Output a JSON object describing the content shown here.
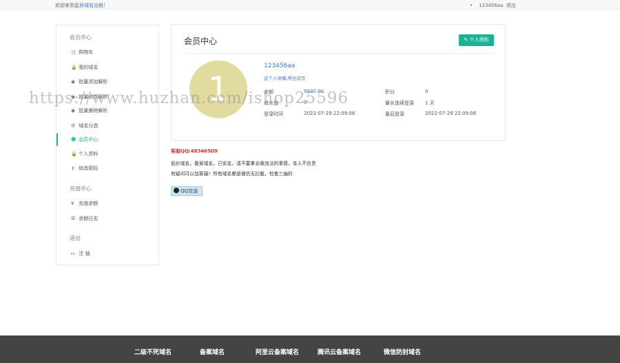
{
  "topbar": {
    "welcome_prefix": "欢迎来到",
    "welcome_site": "星辰域名出租！",
    "user_bullet": "•",
    "username": "123456aa",
    "logout": "退出"
  },
  "sidebar": {
    "groups": [
      {
        "label": "会员中心"
      },
      {
        "label": "充值中心"
      },
      {
        "label": "退出"
      }
    ],
    "items": [
      {
        "icon": "cart-icon",
        "glyph": "🛒",
        "label": "购物车"
      },
      {
        "icon": "lock-icon",
        "glyph": "🔒",
        "label": "我的域名"
      },
      {
        "icon": "globe-icon",
        "glyph": "◉",
        "label": "批量添加解析"
      },
      {
        "icon": "globe-icon",
        "glyph": "◉",
        "label": "批量修改解析"
      },
      {
        "icon": "globe-icon",
        "glyph": "◉",
        "label": "批量删除解析"
      },
      {
        "icon": "gears-icon",
        "glyph": "⚙",
        "label": "域名分选"
      },
      {
        "icon": "user-circle-icon",
        "glyph": "☻",
        "label": "会员中心"
      },
      {
        "icon": "lock-icon",
        "glyph": "🔒",
        "label": "个人资料"
      },
      {
        "icon": "key-icon",
        "glyph": "⚷",
        "label": "修改密码"
      },
      {
        "icon": "yen-icon",
        "glyph": "¥",
        "label": "充值余额"
      },
      {
        "icon": "list-icon",
        "glyph": "☰",
        "label": "余额日志"
      },
      {
        "icon": "signout-icon",
        "glyph": "↦",
        "label": "注 销"
      }
    ]
  },
  "panel": {
    "title": "会员中心",
    "profile_button": "个人资料",
    "avatar_text": "1",
    "username": "123456aa",
    "signature": "这个人很懒,啥也没写",
    "stats": [
      {
        "label": "余额",
        "value": "9930.00"
      },
      {
        "label": "积分",
        "value": "0"
      },
      {
        "label": "成长值",
        "value": "0"
      },
      {
        "label": "最长连续登录",
        "value": "1 天"
      },
      {
        "label": "登录时间",
        "value": "2022-07-29 22:09:06"
      },
      {
        "label": "最后登录",
        "value": "2022-07-29 22:09:06"
      }
    ]
  },
  "notice": {
    "qq_line": "客服QQ:48346509",
    "line1": "低价域名，备案域名，已实名。请不要拿去做违法的事情，本人不负责",
    "line2": "有疑问可以加客服！所有域名都是微信无拦截，检查三遍的",
    "qq_button": "QQ交谈"
  },
  "watermark": "https://www.huzhan.com/ishop25596",
  "footer": {
    "links": [
      {
        "label": "二级不死域名"
      },
      {
        "label": "备案域名"
      },
      {
        "label": "阿里云备案域名"
      },
      {
        "label": "腾讯云备案域名"
      },
      {
        "label": "微信防封域名"
      }
    ]
  },
  "colors": {
    "accent": "#1cb394",
    "link": "#3a7bd5",
    "avatar": "#e1dba0",
    "footer": "#444444",
    "alert": "#d9332c"
  }
}
